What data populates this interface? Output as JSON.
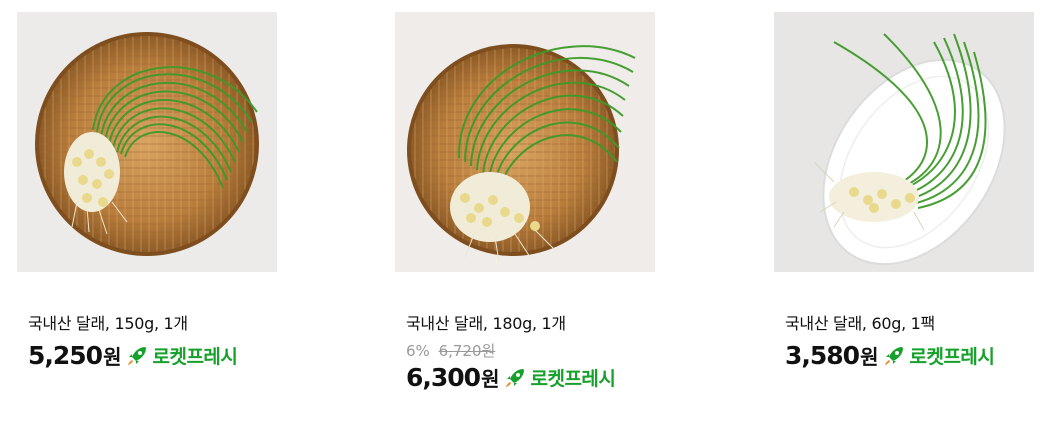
{
  "products": [
    {
      "name": "국내산 달래, 150g, 1개",
      "price": "5,250",
      "currency": "원",
      "delivery_badge": "로켓프레시",
      "image": "wild-chive-on-round-bamboo-basket"
    },
    {
      "name": "국내산 달래, 180g, 1개",
      "discount_rate": "6%",
      "original_price": "6,720원",
      "price": "6,300",
      "currency": "원",
      "delivery_badge": "로켓프레시",
      "image": "wild-chive-on-round-bamboo-basket"
    },
    {
      "name": "국내산 달래, 60g, 1팩",
      "price": "3,580",
      "currency": "원",
      "delivery_badge": "로켓프레시",
      "image": "wild-chive-on-white-oval-plate"
    }
  ],
  "colors": {
    "badge_green": "#16a12a",
    "rocket_orange": "#f08a24",
    "strike_gray": "#9a9a9a"
  }
}
